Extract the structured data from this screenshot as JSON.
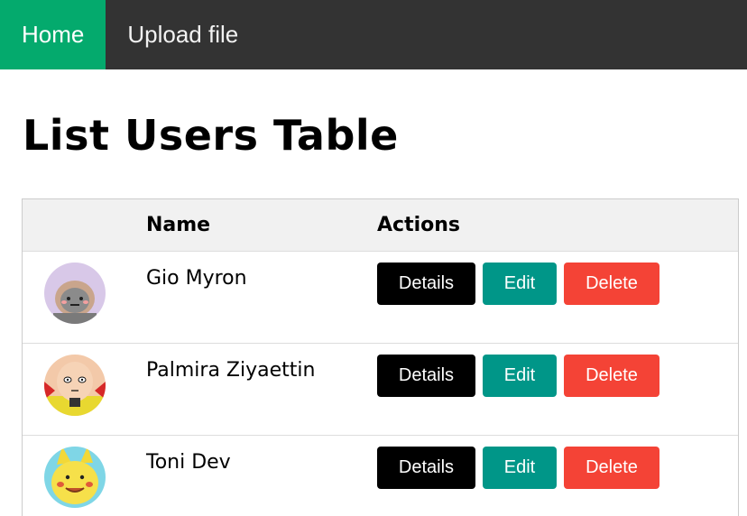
{
  "nav": {
    "items": [
      {
        "label": "Home",
        "active": true
      },
      {
        "label": "Upload file",
        "active": false
      }
    ],
    "active_color": "#04AA6D",
    "bg_color": "#333333"
  },
  "page": {
    "title": "List Users Table"
  },
  "table": {
    "headers": {
      "avatar": "",
      "name": "Name",
      "actions": "Actions"
    },
    "rows": [
      {
        "avatar_icon": "cat-avatar-icon",
        "name": "Gio Myron"
      },
      {
        "avatar_icon": "bald-hero-avatar-icon",
        "name": "Palmira Ziyaettin"
      },
      {
        "avatar_icon": "pikachu-avatar-icon",
        "name": "Toni Dev"
      }
    ]
  },
  "actions": {
    "details_label": "Details",
    "edit_label": "Edit",
    "delete_label": "Delete",
    "details_color": "#000000",
    "edit_color": "#009688",
    "delete_color": "#f44336"
  }
}
